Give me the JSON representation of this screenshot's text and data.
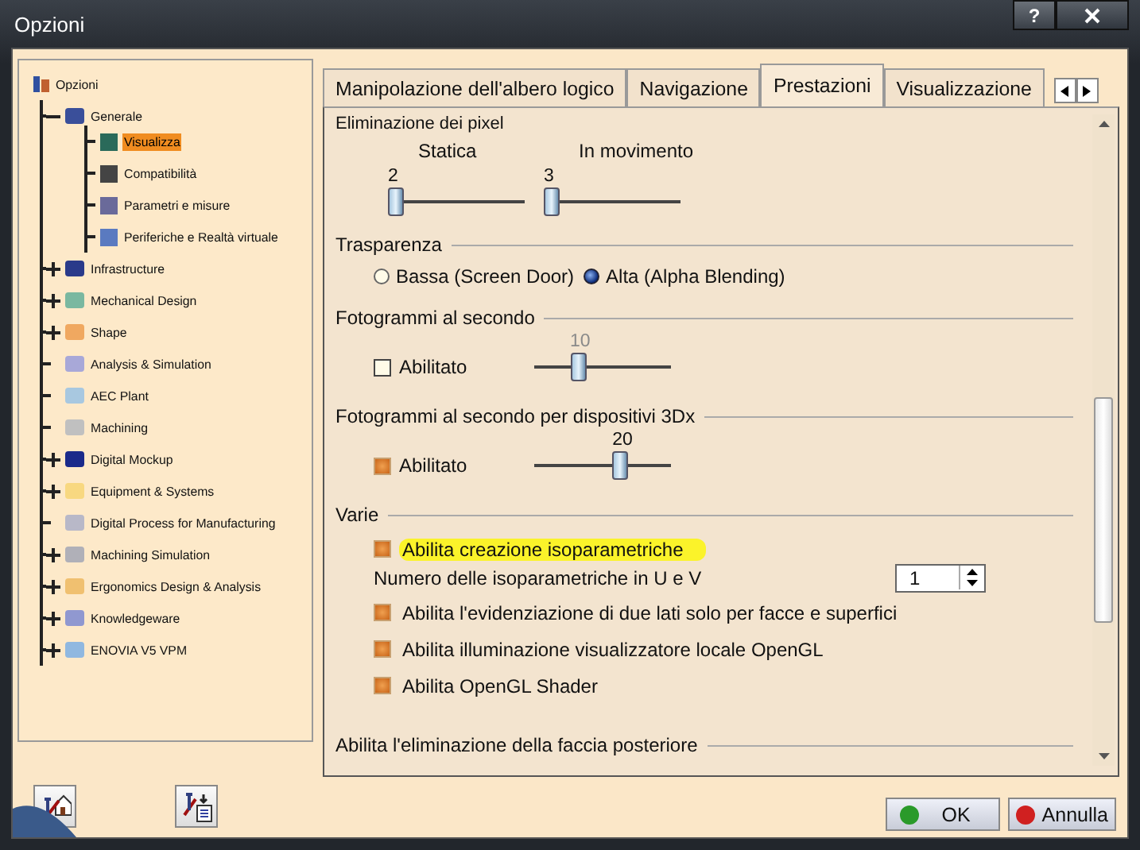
{
  "window": {
    "title": "Opzioni",
    "buttons": [
      "?"
    ]
  },
  "tree": {
    "label": "Opzioni",
    "children": [
      {
        "label": "Generale",
        "expanded": true,
        "color": "#3a4f9a",
        "selected": false,
        "children": [
          {
            "label": "Visualizza",
            "color": "#2a6a5a",
            "selected": true
          },
          {
            "label": "Compatibilità",
            "color": "#444444",
            "selected": false
          },
          {
            "label": "Parametri e misure",
            "color": "#6a6a9a",
            "selected": false
          },
          {
            "label": "Periferiche e Realtà virtuale",
            "color": "#5a7ac0",
            "selected": false
          }
        ]
      },
      {
        "label": "Infrastructure",
        "expanded": false,
        "color": "#2a3a8a",
        "selected": false
      },
      {
        "label": "Mechanical Design",
        "expanded": false,
        "color": "#7ab8a0",
        "selected": false
      },
      {
        "label": "Shape",
        "expanded": false,
        "color": "#f0a860",
        "selected": false
      },
      {
        "label": "Analysis & Simulation",
        "color": "#a8a8d8",
        "selected": false
      },
      {
        "label": "AEC Plant",
        "color": "#a8c8e0",
        "selected": false
      },
      {
        "label": "Machining",
        "color": "#c0c0c0",
        "selected": false
      },
      {
        "label": "Digital Mockup",
        "expanded": false,
        "color": "#1a2a8a",
        "selected": false
      },
      {
        "label": "Equipment & Systems",
        "expanded": false,
        "color": "#f8d880",
        "selected": false
      },
      {
        "label": "Digital Process for Manufacturing",
        "color": "#b8b8c8",
        "selected": false
      },
      {
        "label": "Machining Simulation",
        "expanded": false,
        "color": "#b0b0b8",
        "selected": false
      },
      {
        "label": "Ergonomics Design & Analysis",
        "expanded": false,
        "color": "#f0c070",
        "selected": false
      },
      {
        "label": "Knowledgeware",
        "expanded": false,
        "color": "#9098d0",
        "selected": false
      },
      {
        "label": "ENOVIA V5 VPM",
        "expanded": false,
        "color": "#90b8e0",
        "selected": false
      }
    ]
  },
  "tabs": [
    {
      "label": "Manipolazione dell'albero logico",
      "selected": false
    },
    {
      "label": "Navigazione",
      "selected": false
    },
    {
      "label": "Prestazioni",
      "selected": true
    },
    {
      "label": "Visualizzazione",
      "selected": false
    }
  ],
  "pixel_elimination": {
    "title": "Eliminazione dei pixel",
    "sliders": [
      {
        "label": "Statica",
        "value": "2",
        "level": 0
      },
      {
        "label": "In movimento",
        "value": "3",
        "level": 0
      }
    ]
  },
  "transparency": {
    "title": "Trasparenza",
    "options": [
      {
        "label": "Bassa (Screen Door)",
        "selected": false
      },
      {
        "label": "Alta (Alpha Blending)",
        "selected": true
      }
    ]
  },
  "fps": {
    "title": "Fotogrammi al secondo",
    "checkbox": {
      "label": "Abilitato",
      "checked": false
    },
    "slider": {
      "value": "10",
      "level": 0.3,
      "disabled": true
    }
  },
  "fps_3dx": {
    "title": "Fotogrammi al secondo per dispositivi 3Dx",
    "checkbox": {
      "label": "Abilitato",
      "checked": true
    },
    "slider": {
      "value": "20",
      "level": 0.65,
      "disabled": false
    }
  },
  "misc": {
    "title": "Varie",
    "items": [
      {
        "kind": "checkbox",
        "label": "Abilita creazione isoparametriche",
        "checked": true,
        "highlighted": true
      },
      {
        "kind": "spinner",
        "label": "Numero delle isoparametriche in U e V",
        "value": "1"
      },
      {
        "kind": "checkbox",
        "label": "Abilita l'evidenziazione di due lati solo per facce e superfici",
        "checked": true,
        "highlighted": false
      },
      {
        "kind": "checkbox",
        "label": "Abilita illuminazione visualizzatore locale OpenGL",
        "checked": true,
        "highlighted": false
      },
      {
        "kind": "checkbox",
        "label": "Abilita OpenGL Shader",
        "checked": true,
        "highlighted": false
      }
    ]
  },
  "backface": {
    "title": "Abilita l'eliminazione della faccia posteriore"
  },
  "dialog_buttons": [
    {
      "label": "OK",
      "color": "#2a9a2a"
    },
    {
      "label": "Annulla",
      "color": "#d02020"
    }
  ]
}
